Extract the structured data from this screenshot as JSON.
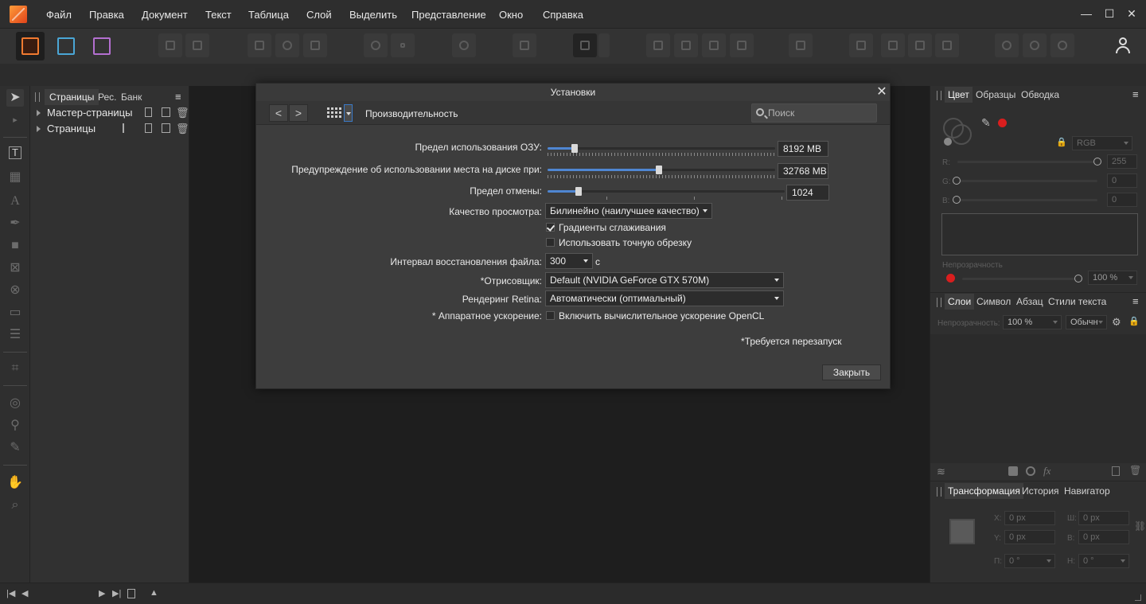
{
  "menu": [
    "Файл",
    "Правка",
    "Документ",
    "Текст",
    "Таблица",
    "Слой",
    "Выделить",
    "Представление",
    "Окно",
    "Справка"
  ],
  "window_controls": {
    "minimize": "—",
    "maximize": "☐",
    "close": "✕"
  },
  "pages_panel": {
    "tabs": [
      "Страницы",
      "Рес.",
      "Банк"
    ],
    "menu_icon": "≡",
    "tree": [
      "Мастер-страницы",
      "Страницы"
    ]
  },
  "dialog": {
    "title": "Установки",
    "close": "✕",
    "nav_back": "<",
    "nav_forward": ">",
    "section": "Производительность",
    "search_placeholder": "Поиск",
    "ram_limit": {
      "label": "Предел использования ОЗУ:",
      "value": "8192 MB",
      "fraction": 0.12
    },
    "disk_warning": {
      "label": "Предупреждение об использовании места на диске при:",
      "value": "32768 MB",
      "fraction": 0.49
    },
    "undo_limit": {
      "label": "Предел отмены:",
      "value": "1024",
      "fraction": 0.13
    },
    "view_quality": {
      "label": "Качество просмотра:",
      "value": "Билинейно (наилучшее качество)"
    },
    "dither_gradients": {
      "label": "Градиенты сглаживания",
      "checked": true
    },
    "precise_clipping": {
      "label": "Использовать точную обрезку",
      "checked": false
    },
    "recovery_interval": {
      "label": "Интервал восстановления файла:",
      "value": "300",
      "unit": "с"
    },
    "renderer": {
      "label": "*Отрисовщик:",
      "value": "Default (NVIDIA GeForce GTX 570M)"
    },
    "retina": {
      "label": "Рендеринг Retina:",
      "value": "Автоматически (оптимальный)"
    },
    "hw_accel": {
      "label": "* Аппаратное ускорение:",
      "option": "Включить вычислительное ускорение OpenCL",
      "checked": false
    },
    "restart_note": "*Требуется перезапуск",
    "close_button": "Закрыть"
  },
  "color_panel": {
    "tabs": [
      "Цвет",
      "Образцы",
      "Обводка"
    ],
    "model": "RGB",
    "r_label": "R:",
    "r_value": "255",
    "g_label": "G:",
    "g_value": "0",
    "b_label": "B:",
    "b_value": "0",
    "opacity_label": "Непрозрачность",
    "opacity_value": "100 %",
    "swatch_color": "#d91e1e"
  },
  "layers_panel": {
    "tabs": [
      "Слои",
      "Символ",
      "Абзац",
      "Стили текста"
    ],
    "opacity_label": "Непрозрачность:",
    "opacity_value": "100 %",
    "blend_mode": "Обычн"
  },
  "transform_panel": {
    "tabs": [
      "Трансформация",
      "История",
      "Навигатор"
    ],
    "x_label": "X:",
    "x_value": "0 px",
    "w_label": "Ш:",
    "w_value": "0 px",
    "y_label": "Y:",
    "y_value": "0 px",
    "h_label": "В:",
    "h_value": "0 px",
    "r_label": "П:",
    "r_value": "0 °",
    "s_label": "Н:",
    "s_value": "0 °"
  },
  "accent_color": "#4f86d2"
}
